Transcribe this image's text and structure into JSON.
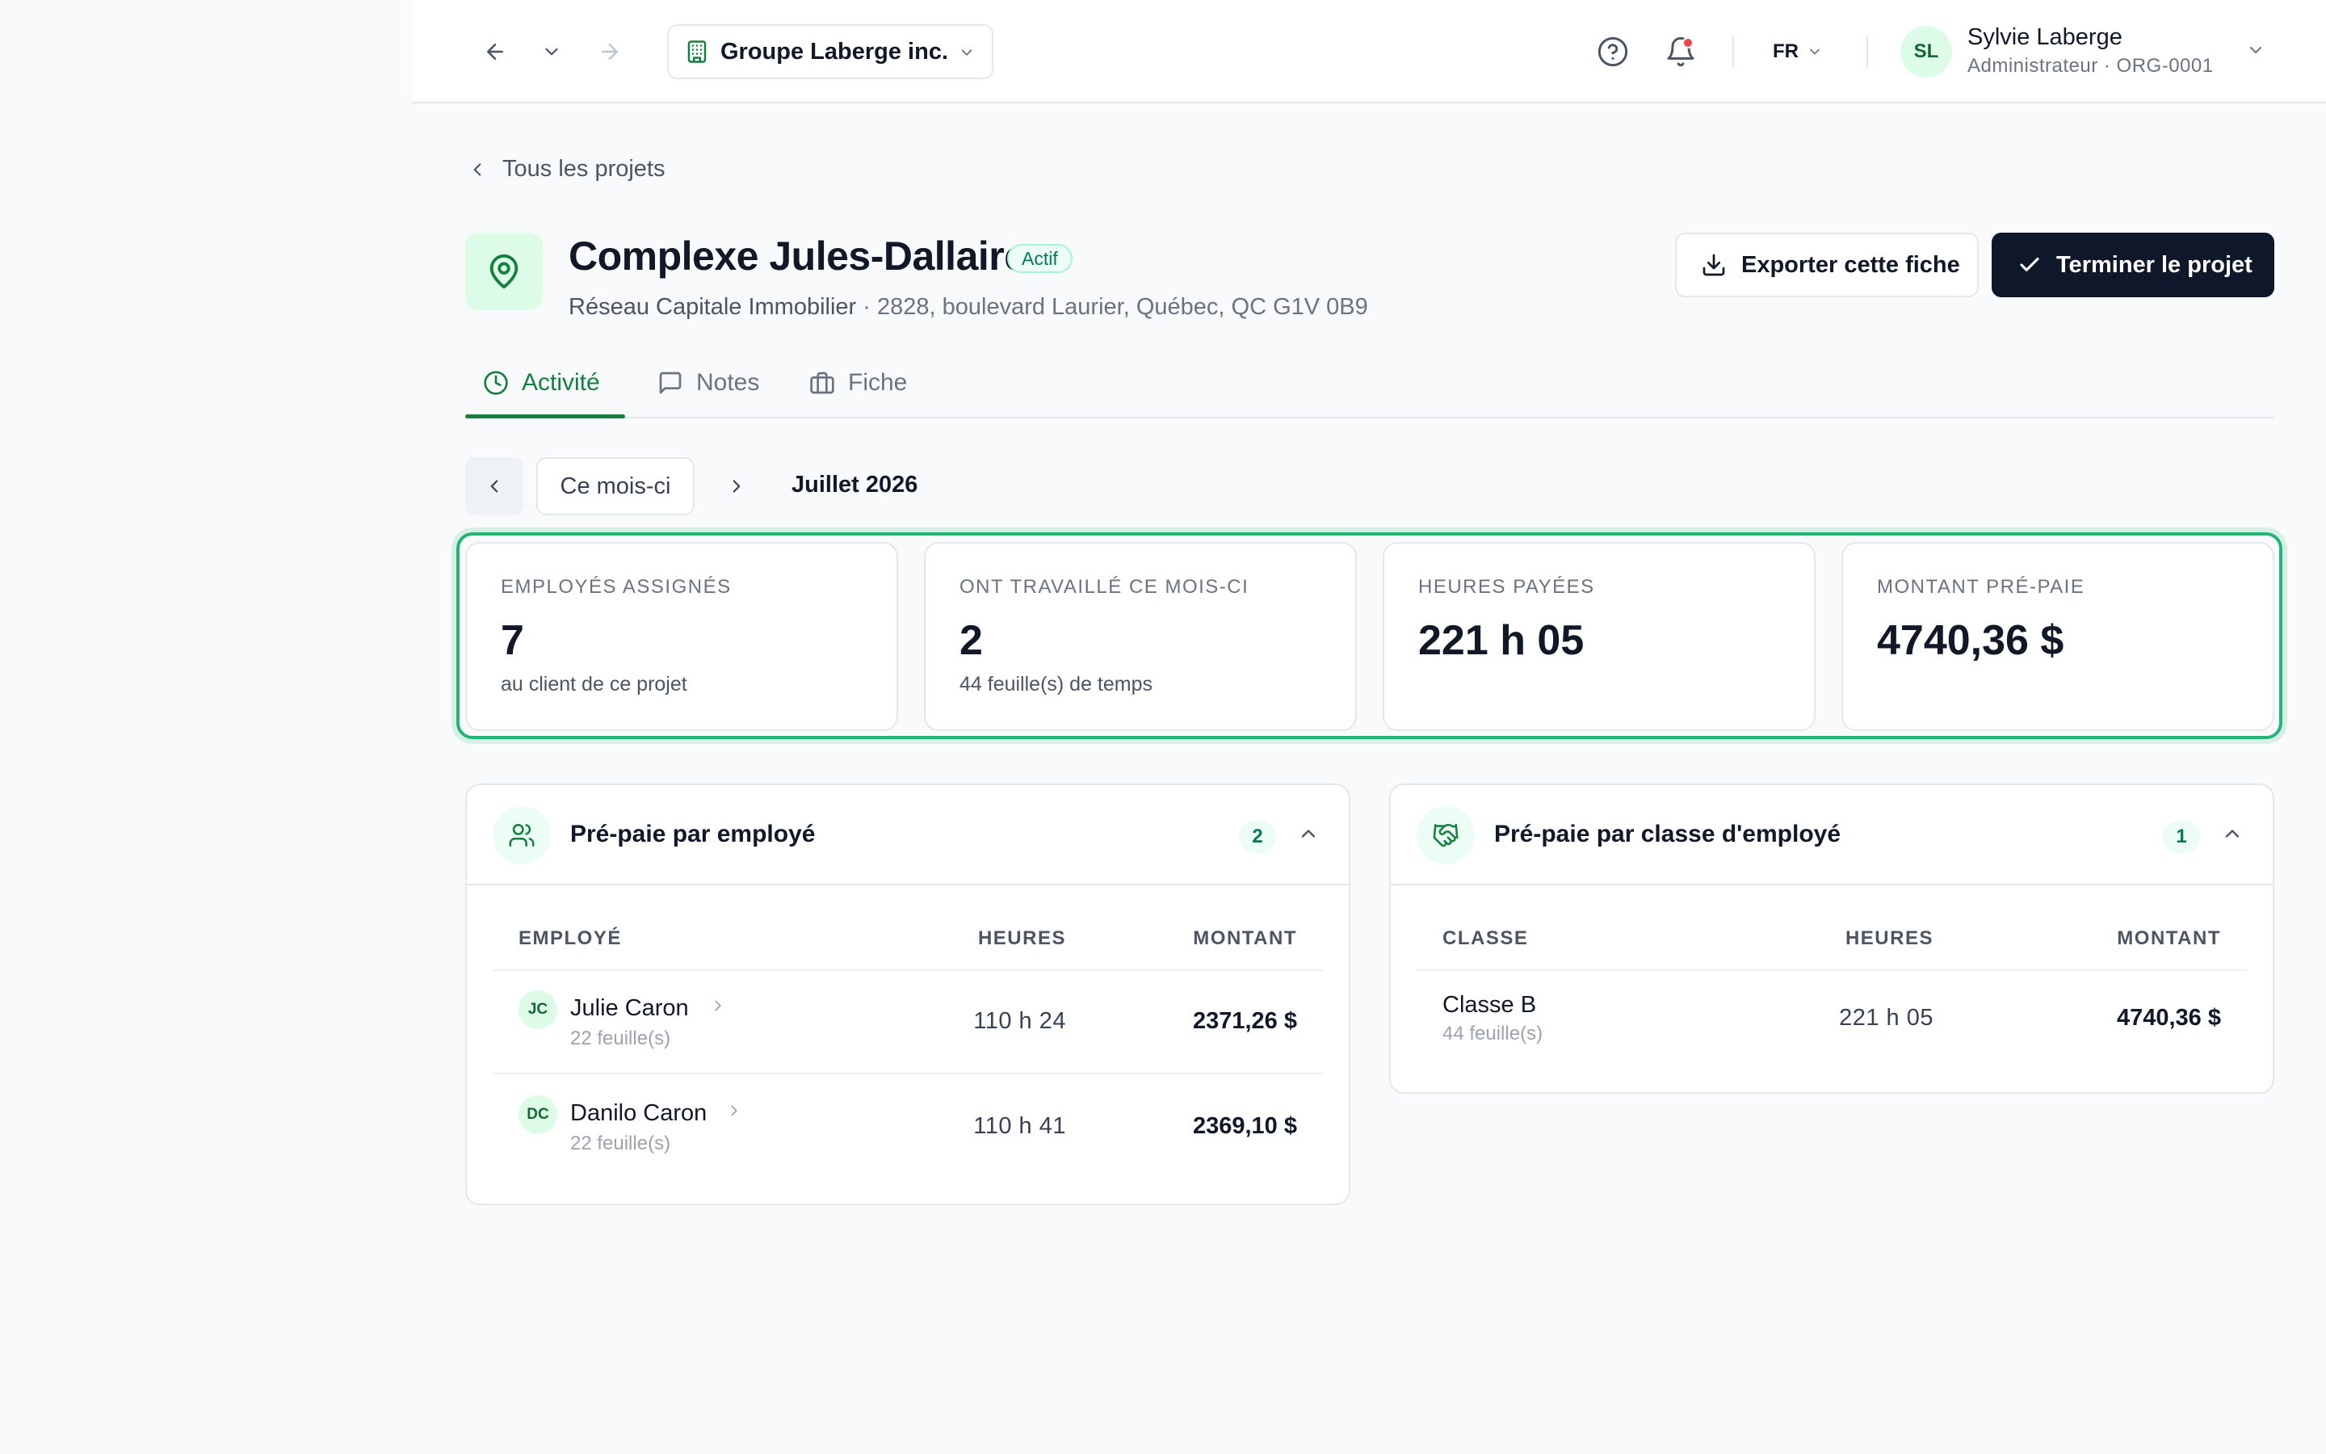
{
  "topbar": {
    "org_name": "Groupe Laberge inc.",
    "lang": "FR",
    "user": {
      "initials": "SL",
      "name": "Sylvie Laberge",
      "role": "Administrateur · ORG-0001"
    }
  },
  "breadcrumb": {
    "back_label": "Tous les projets"
  },
  "project": {
    "title": "Complexe Jules-Dallaire",
    "status": "Actif",
    "client": "Réseau Capitale Immobilier",
    "address": " · 2828, boulevard Laurier, Québec, QC G1V 0B9",
    "export_label": "Exporter cette fiche",
    "finish_label": "Terminer le projet"
  },
  "tabs": [
    {
      "label": "Activité",
      "active": true
    },
    {
      "label": "Notes",
      "active": false
    },
    {
      "label": "Fiche",
      "active": false
    }
  ],
  "period": {
    "current_label": "Ce mois-ci",
    "month_label": "Juillet 2026"
  },
  "stats": [
    {
      "label": "EMPLOYÉS ASSIGNÉS",
      "value": "7",
      "sub": "au client de ce projet"
    },
    {
      "label": "ONT TRAVAILLÉ CE MOIS-CI",
      "value": "2",
      "sub": "44 feuille(s) de temps"
    },
    {
      "label": "HEURES PAYÉES",
      "value": "221 h 05",
      "sub": ""
    },
    {
      "label": "MONTANT PRÉ-PAIE",
      "value": "4740,36 $",
      "sub": ""
    }
  ],
  "by_employee": {
    "title": "Pré-paie par employé",
    "count": "2",
    "columns": {
      "name": "EMPLOYÉ",
      "hours": "HEURES",
      "amount": "MONTANT"
    },
    "rows": [
      {
        "initials": "JC",
        "name": "Julie Caron",
        "sheets": "22 feuille(s)",
        "hours": "110 h 24",
        "amount": "2371,26 $"
      },
      {
        "initials": "DC",
        "name": "Danilo Caron",
        "sheets": "22 feuille(s)",
        "hours": "110 h 41",
        "amount": "2369,10 $"
      }
    ]
  },
  "by_class": {
    "title": "Pré-paie par classe d'employé",
    "count": "1",
    "columns": {
      "name": "CLASSE",
      "hours": "HEURES",
      "amount": "MONTANT"
    },
    "rows": [
      {
        "name": "Classe B",
        "sheets": "44 feuille(s)",
        "hours": "221 h 05",
        "amount": "4740,36 $"
      }
    ]
  },
  "colors": {
    "accent": "#15803d",
    "primary_button": "#0f172a",
    "highlight": "#22b573",
    "notification": "#ef4444"
  }
}
